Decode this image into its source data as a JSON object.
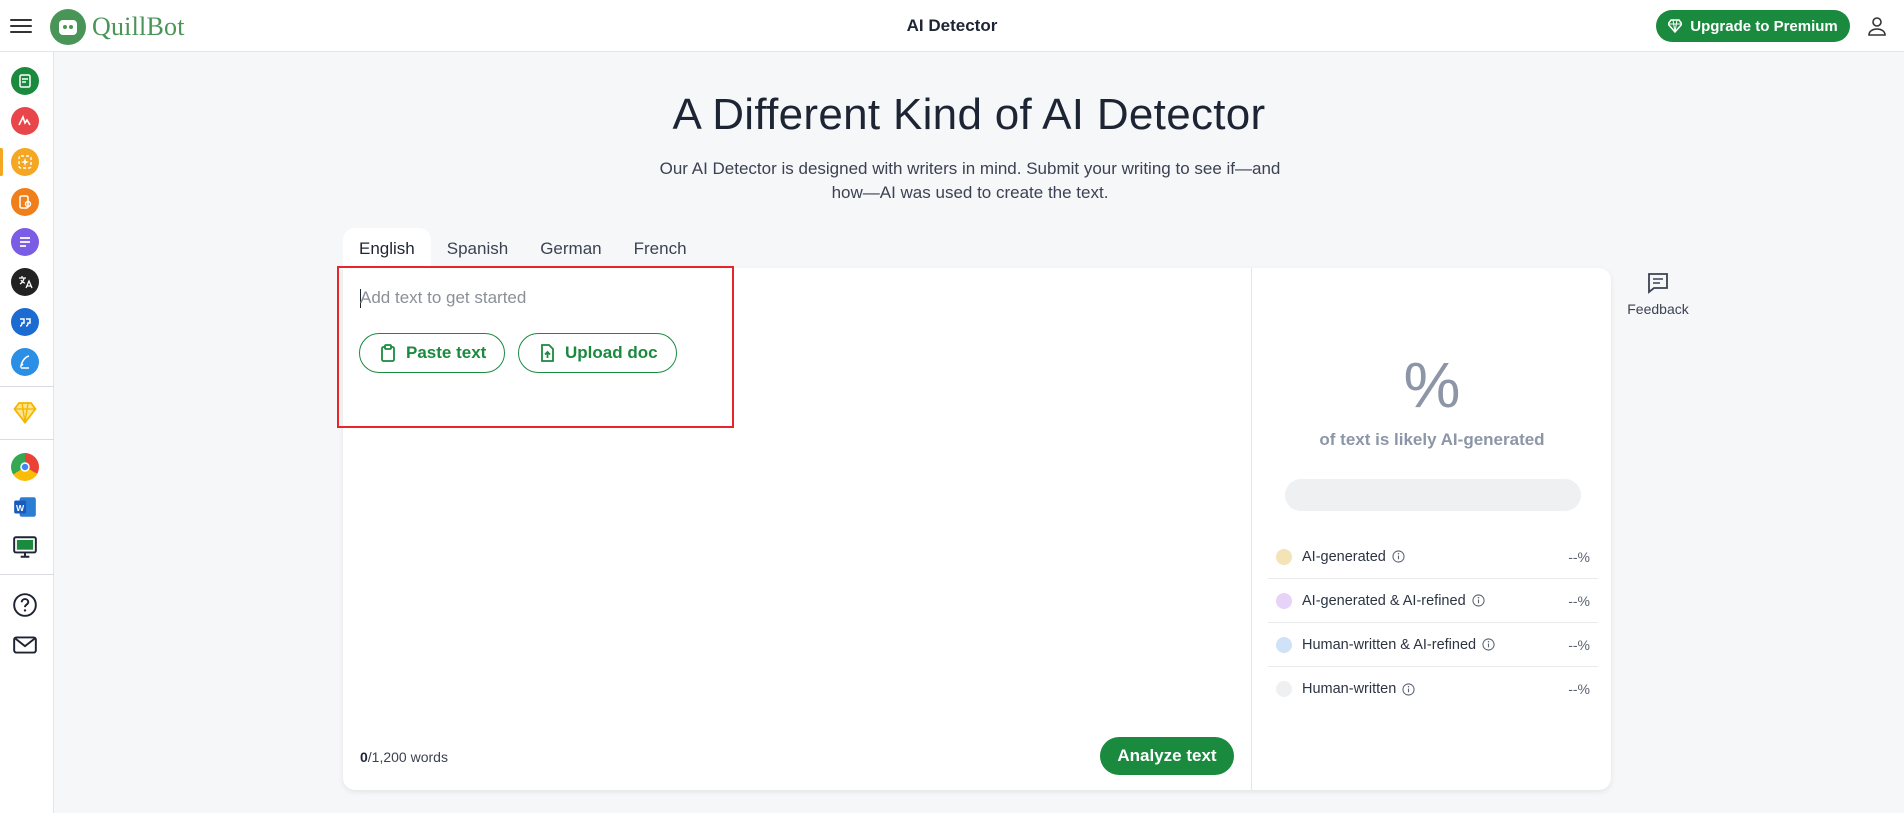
{
  "header": {
    "logo_text": "QuillBot",
    "title": "AI Detector",
    "premium_label": "Upgrade to Premium"
  },
  "sidebar": {
    "items": [
      {
        "name": "paraphraser-icon",
        "color": "#1a8a3f"
      },
      {
        "name": "grammar-checker-icon",
        "color": "#e8464a"
      },
      {
        "name": "ai-detector-icon",
        "color": "#f5a623"
      },
      {
        "name": "plagiarism-checker-icon",
        "color": "#f07f1a"
      },
      {
        "name": "summarizer-icon",
        "color": "#7b5ce5"
      },
      {
        "name": "translator-icon",
        "color": "#222222"
      },
      {
        "name": "citation-generator-icon",
        "color": "#1c6bd2"
      },
      {
        "name": "ai-writer-icon",
        "color": "#2b8fe6"
      },
      {
        "name": "premium-diamond-icon",
        "color": "#f5b400"
      },
      {
        "name": "chrome-extension-icon",
        "color": "#4285f4"
      },
      {
        "name": "word-addin-icon",
        "color": "#2b5797"
      },
      {
        "name": "desktop-app-icon",
        "color": "#1a8a3f"
      },
      {
        "name": "help-icon",
        "color": "#1d2433"
      },
      {
        "name": "mail-icon",
        "color": "#1d2433"
      }
    ]
  },
  "hero": {
    "title": "A Different Kind of AI Detector",
    "subtitle": "Our AI Detector is designed with writers in mind. Submit your writing to see if—and how—AI was used to create the text."
  },
  "tabs": [
    "English",
    "Spanish",
    "German",
    "French"
  ],
  "active_tab": "English",
  "editor": {
    "placeholder": "Add text to get started",
    "paste_label": "Paste text",
    "upload_label": "Upload doc",
    "word_count_current": "0",
    "word_count_limit": "/1,200 words",
    "analyze_label": "Analyze text"
  },
  "results": {
    "percent": "%",
    "likely_text": "of text is likely AI-generated",
    "legend": [
      {
        "label": "AI-generated",
        "value": "--%",
        "color": "#f3e3b6"
      },
      {
        "label": "AI-generated & AI-refined",
        "value": "--%",
        "color": "#e7d3f7"
      },
      {
        "label": "Human-written & AI-refined",
        "value": "--%",
        "color": "#cfe2f8"
      },
      {
        "label": "Human-written",
        "value": "--%",
        "color": "#eef0f2"
      }
    ]
  },
  "feedback": {
    "label": "Feedback"
  },
  "colors": {
    "brand_green": "#1a8a3f",
    "highlight_red": "#e8262a"
  }
}
